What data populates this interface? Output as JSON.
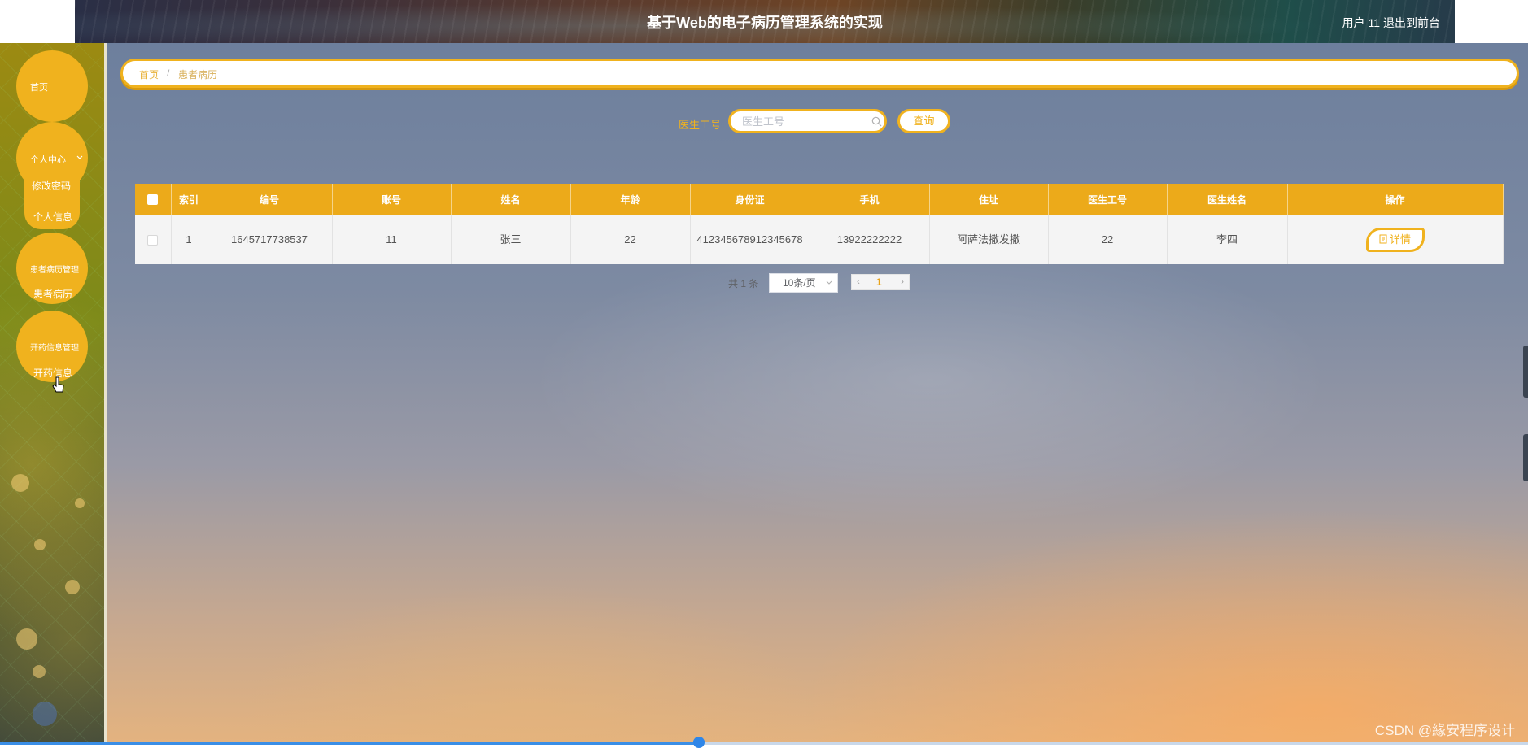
{
  "header": {
    "title": "基于Web的电子病历管理系统的实现",
    "user": "用户 11",
    "logout": "退出到前台"
  },
  "sidebar": {
    "home": "首页",
    "personal_center": "个人中心",
    "change_password": "修改密码",
    "personal_info": "个人信息",
    "record_management": "患者病历管理",
    "patient_records": "患者病历",
    "prescription_management": "开药信息管理",
    "prescription_info": "开药信息"
  },
  "breadcrumb": {
    "home": "首页",
    "separator": "/",
    "current": "患者病历"
  },
  "search": {
    "label": "医生工号",
    "placeholder": "医生工号",
    "value": "",
    "button": "查询"
  },
  "table": {
    "headers": [
      "索引",
      "编号",
      "账号",
      "姓名",
      "年龄",
      "身份证",
      "手机",
      "住址",
      "医生工号",
      "医生姓名",
      "操作"
    ],
    "rows": [
      {
        "index": "1",
        "number": "1645717738537",
        "account": "11",
        "name": "张三",
        "age": "22",
        "id_card": "412345678912345678",
        "phone": "13922222222",
        "address": "阿萨法撒发撒",
        "doctor_id": "22",
        "doctor_name": "李四",
        "action": "详情"
      }
    ]
  },
  "pagination": {
    "total": "共 1 条",
    "page_size": "10条/页",
    "current_page": "1",
    "prev": "‹",
    "next": "›"
  },
  "watermark": "CSDN @緣安程序设计",
  "colors": {
    "accent": "#f0b21e",
    "table_header": "#ecaa1a",
    "page_active": "#e8a31a"
  },
  "icons": [
    "chevron-down-icon",
    "search-icon",
    "document-icon",
    "chevron-left-icon",
    "chevron-right-icon",
    "pointer-cursor-icon"
  ]
}
